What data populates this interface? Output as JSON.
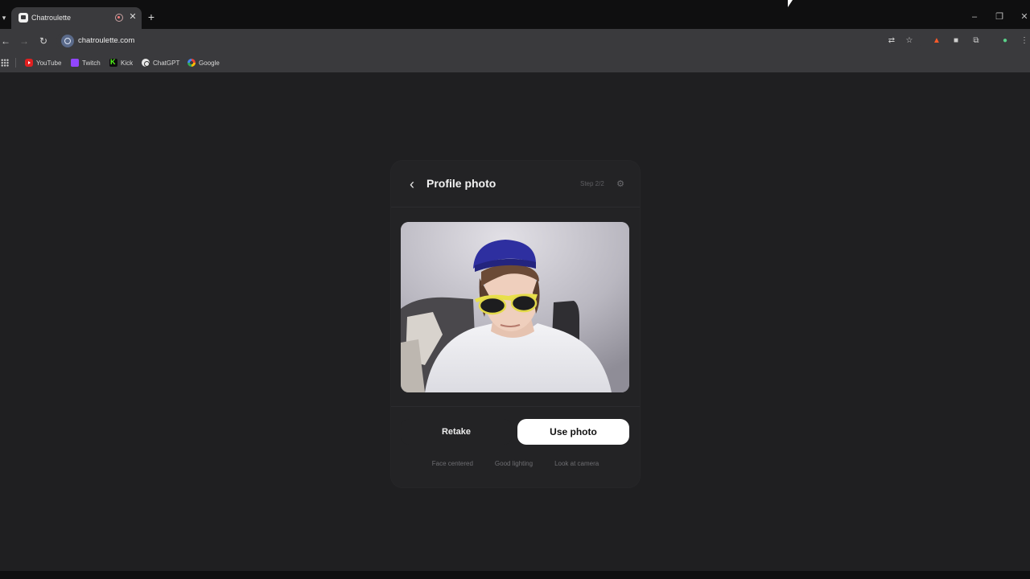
{
  "browser": {
    "tab": {
      "title": "Chatroulette"
    },
    "new_tab_symbol": "+",
    "url": "chatroulette.com",
    "bookmarks": [
      {
        "label": "YouTube"
      },
      {
        "label": "Twitch"
      },
      {
        "label": "Kick"
      },
      {
        "label": "ChatGPT"
      },
      {
        "label": "Google"
      }
    ]
  },
  "card": {
    "title": "Profile photo",
    "step": "Step 2/2",
    "retake_label": "Retake",
    "use_label": "Use photo",
    "hints": [
      "Face centered",
      "Good lighting",
      "Look at camera"
    ]
  },
  "colors": {
    "page_bg": "#1f1f21",
    "card_bg": "#232325",
    "primary_button_bg": "#ffffff",
    "primary_button_text": "#111111"
  }
}
